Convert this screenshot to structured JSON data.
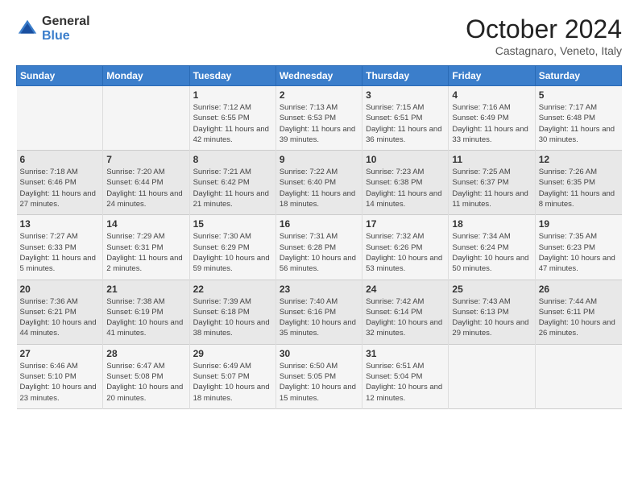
{
  "header": {
    "logo_general": "General",
    "logo_blue": "Blue",
    "title": "October 2024",
    "subtitle": "Castagnaro, Veneto, Italy"
  },
  "weekdays": [
    "Sunday",
    "Monday",
    "Tuesday",
    "Wednesday",
    "Thursday",
    "Friday",
    "Saturday"
  ],
  "weeks": [
    [
      {
        "day": "",
        "info": ""
      },
      {
        "day": "",
        "info": ""
      },
      {
        "day": "1",
        "info": "Sunrise: 7:12 AM\nSunset: 6:55 PM\nDaylight: 11 hours and 42 minutes."
      },
      {
        "day": "2",
        "info": "Sunrise: 7:13 AM\nSunset: 6:53 PM\nDaylight: 11 hours and 39 minutes."
      },
      {
        "day": "3",
        "info": "Sunrise: 7:15 AM\nSunset: 6:51 PM\nDaylight: 11 hours and 36 minutes."
      },
      {
        "day": "4",
        "info": "Sunrise: 7:16 AM\nSunset: 6:49 PM\nDaylight: 11 hours and 33 minutes."
      },
      {
        "day": "5",
        "info": "Sunrise: 7:17 AM\nSunset: 6:48 PM\nDaylight: 11 hours and 30 minutes."
      }
    ],
    [
      {
        "day": "6",
        "info": "Sunrise: 7:18 AM\nSunset: 6:46 PM\nDaylight: 11 hours and 27 minutes."
      },
      {
        "day": "7",
        "info": "Sunrise: 7:20 AM\nSunset: 6:44 PM\nDaylight: 11 hours and 24 minutes."
      },
      {
        "day": "8",
        "info": "Sunrise: 7:21 AM\nSunset: 6:42 PM\nDaylight: 11 hours and 21 minutes."
      },
      {
        "day": "9",
        "info": "Sunrise: 7:22 AM\nSunset: 6:40 PM\nDaylight: 11 hours and 18 minutes."
      },
      {
        "day": "10",
        "info": "Sunrise: 7:23 AM\nSunset: 6:38 PM\nDaylight: 11 hours and 14 minutes."
      },
      {
        "day": "11",
        "info": "Sunrise: 7:25 AM\nSunset: 6:37 PM\nDaylight: 11 hours and 11 minutes."
      },
      {
        "day": "12",
        "info": "Sunrise: 7:26 AM\nSunset: 6:35 PM\nDaylight: 11 hours and 8 minutes."
      }
    ],
    [
      {
        "day": "13",
        "info": "Sunrise: 7:27 AM\nSunset: 6:33 PM\nDaylight: 11 hours and 5 minutes."
      },
      {
        "day": "14",
        "info": "Sunrise: 7:29 AM\nSunset: 6:31 PM\nDaylight: 11 hours and 2 minutes."
      },
      {
        "day": "15",
        "info": "Sunrise: 7:30 AM\nSunset: 6:29 PM\nDaylight: 10 hours and 59 minutes."
      },
      {
        "day": "16",
        "info": "Sunrise: 7:31 AM\nSunset: 6:28 PM\nDaylight: 10 hours and 56 minutes."
      },
      {
        "day": "17",
        "info": "Sunrise: 7:32 AM\nSunset: 6:26 PM\nDaylight: 10 hours and 53 minutes."
      },
      {
        "day": "18",
        "info": "Sunrise: 7:34 AM\nSunset: 6:24 PM\nDaylight: 10 hours and 50 minutes."
      },
      {
        "day": "19",
        "info": "Sunrise: 7:35 AM\nSunset: 6:23 PM\nDaylight: 10 hours and 47 minutes."
      }
    ],
    [
      {
        "day": "20",
        "info": "Sunrise: 7:36 AM\nSunset: 6:21 PM\nDaylight: 10 hours and 44 minutes."
      },
      {
        "day": "21",
        "info": "Sunrise: 7:38 AM\nSunset: 6:19 PM\nDaylight: 10 hours and 41 minutes."
      },
      {
        "day": "22",
        "info": "Sunrise: 7:39 AM\nSunset: 6:18 PM\nDaylight: 10 hours and 38 minutes."
      },
      {
        "day": "23",
        "info": "Sunrise: 7:40 AM\nSunset: 6:16 PM\nDaylight: 10 hours and 35 minutes."
      },
      {
        "day": "24",
        "info": "Sunrise: 7:42 AM\nSunset: 6:14 PM\nDaylight: 10 hours and 32 minutes."
      },
      {
        "day": "25",
        "info": "Sunrise: 7:43 AM\nSunset: 6:13 PM\nDaylight: 10 hours and 29 minutes."
      },
      {
        "day": "26",
        "info": "Sunrise: 7:44 AM\nSunset: 6:11 PM\nDaylight: 10 hours and 26 minutes."
      }
    ],
    [
      {
        "day": "27",
        "info": "Sunrise: 6:46 AM\nSunset: 5:10 PM\nDaylight: 10 hours and 23 minutes."
      },
      {
        "day": "28",
        "info": "Sunrise: 6:47 AM\nSunset: 5:08 PM\nDaylight: 10 hours and 20 minutes."
      },
      {
        "day": "29",
        "info": "Sunrise: 6:49 AM\nSunset: 5:07 PM\nDaylight: 10 hours and 18 minutes."
      },
      {
        "day": "30",
        "info": "Sunrise: 6:50 AM\nSunset: 5:05 PM\nDaylight: 10 hours and 15 minutes."
      },
      {
        "day": "31",
        "info": "Sunrise: 6:51 AM\nSunset: 5:04 PM\nDaylight: 10 hours and 12 minutes."
      },
      {
        "day": "",
        "info": ""
      },
      {
        "day": "",
        "info": ""
      }
    ]
  ]
}
